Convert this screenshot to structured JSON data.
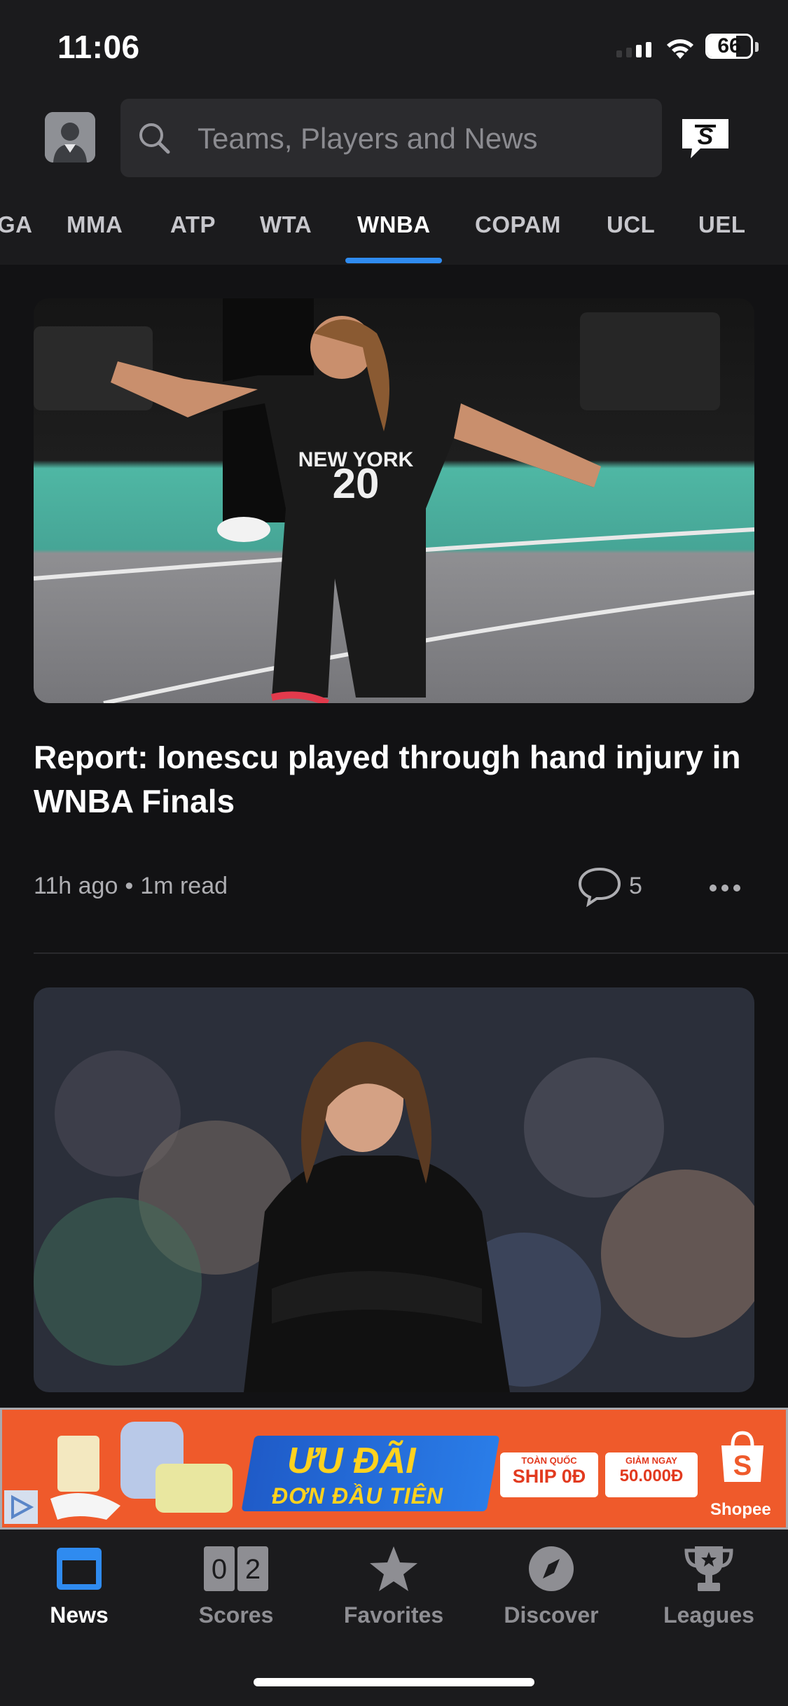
{
  "status_bar": {
    "time": "11:06",
    "battery": "66",
    "battery_level": 0.66
  },
  "search": {
    "placeholder": "Teams, Players and News"
  },
  "tabs": [
    {
      "label": "GA"
    },
    {
      "label": "MMA"
    },
    {
      "label": "ATP"
    },
    {
      "label": "WTA"
    },
    {
      "label": "WNBA",
      "active": true
    },
    {
      "label": "COPAM"
    },
    {
      "label": "UCL"
    },
    {
      "label": "UEL"
    }
  ],
  "articles": [
    {
      "headline": "Report: Ionescu played through hand injury in WNBA Finals",
      "age": "11h ago",
      "read_time": "1m read",
      "comments": "5"
    }
  ],
  "ad": {
    "line1": "ƯU ĐÃI",
    "line2": "ĐƠN ĐẦU TIÊN",
    "coupon1_small": "TOÀN QUỐC",
    "coupon1_big": "SHIP 0Đ",
    "coupon2_small": "GIẢM NGAY",
    "coupon2_big": "50.000Đ",
    "brand": "Shopee"
  },
  "bottom_nav": [
    {
      "label": "News",
      "icon": "news-icon",
      "active": true
    },
    {
      "label": "Scores",
      "icon": "scores-icon"
    },
    {
      "label": "Favorites",
      "icon": "star-icon"
    },
    {
      "label": "Discover",
      "icon": "compass-icon"
    },
    {
      "label": "Leagues",
      "icon": "trophy-icon"
    }
  ],
  "scores_icon_digits": [
    "0",
    "2"
  ],
  "colors": {
    "accent": "#2f8bf0",
    "background": "#121214",
    "header": "#1b1b1d"
  }
}
